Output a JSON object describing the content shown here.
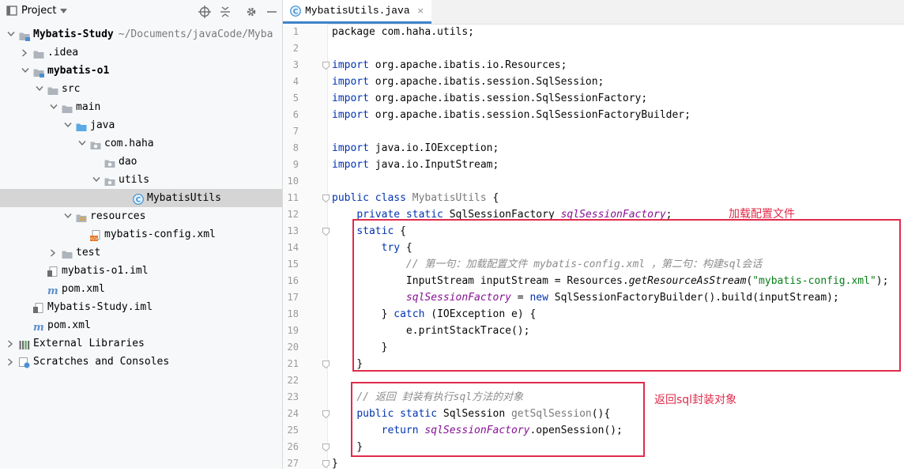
{
  "panel": {
    "title": "Project",
    "toolbar_icons": [
      "locate-icon",
      "collapse-icon",
      "gear-icon",
      "minimize-icon"
    ]
  },
  "tree": [
    {
      "label": "Mybatis-Study",
      "path": "~/Documents/javaCode/Myba",
      "indent": 0,
      "arrow": "down",
      "icon": "module-folder",
      "bold": true
    },
    {
      "label": ".idea",
      "indent": 1,
      "arrow": "right",
      "icon": "folder"
    },
    {
      "label": "mybatis-o1",
      "indent": 1,
      "arrow": "down",
      "icon": "module-folder",
      "bold": true
    },
    {
      "label": "src",
      "indent": 2,
      "arrow": "down",
      "icon": "folder"
    },
    {
      "label": "main",
      "indent": 3,
      "arrow": "down",
      "icon": "folder"
    },
    {
      "label": "java",
      "indent": 4,
      "arrow": "down",
      "icon": "source-folder"
    },
    {
      "label": "com.haha",
      "indent": 5,
      "arrow": "down",
      "icon": "package"
    },
    {
      "label": "dao",
      "indent": 6,
      "arrow": "none",
      "icon": "package"
    },
    {
      "label": "utils",
      "indent": 6,
      "arrow": "down",
      "icon": "package"
    },
    {
      "label": "MybatisUtils",
      "indent": 8,
      "arrow": "none",
      "icon": "class",
      "selected": true
    },
    {
      "label": "resources",
      "indent": 4,
      "arrow": "down",
      "icon": "resources-folder"
    },
    {
      "label": "mybatis-config.xml",
      "indent": 5,
      "arrow": "none",
      "icon": "xml"
    },
    {
      "label": "test",
      "indent": 3,
      "arrow": "right",
      "icon": "folder"
    },
    {
      "label": "mybatis-o1.iml",
      "indent": 2,
      "arrow": "none",
      "icon": "iml"
    },
    {
      "label": "pom.xml",
      "indent": 2,
      "arrow": "none",
      "icon": "maven"
    },
    {
      "label": "Mybatis-Study.iml",
      "indent": 1,
      "arrow": "none",
      "icon": "iml"
    },
    {
      "label": "pom.xml",
      "indent": 1,
      "arrow": "none",
      "icon": "maven"
    },
    {
      "label": "External Libraries",
      "indent": 0,
      "arrow": "right",
      "icon": "libraries"
    },
    {
      "label": "Scratches and Consoles",
      "indent": 0,
      "arrow": "right",
      "icon": "scratches"
    }
  ],
  "editor": {
    "tab_label": "MybatisUtils.java",
    "tab_close": "×",
    "lines": [
      [
        {
          "t": "package com.haha.utils;",
          "c": ""
        }
      ],
      [],
      [
        {
          "t": "import",
          "c": "kw"
        },
        {
          "t": " org.apache.ibatis.io.Resources;",
          "c": ""
        }
      ],
      [
        {
          "t": "import",
          "c": "kw"
        },
        {
          "t": " org.apache.ibatis.session.SqlSession;",
          "c": ""
        }
      ],
      [
        {
          "t": "import",
          "c": "kw"
        },
        {
          "t": " org.apache.ibatis.session.SqlSessionFactory;",
          "c": ""
        }
      ],
      [
        {
          "t": "import",
          "c": "kw"
        },
        {
          "t": " org.apache.ibatis.session.SqlSessionFactoryBuilder;",
          "c": ""
        }
      ],
      [],
      [
        {
          "t": "import",
          "c": "kw"
        },
        {
          "t": " java.io.IOException;",
          "c": ""
        }
      ],
      [
        {
          "t": "import",
          "c": "kw"
        },
        {
          "t": " java.io.InputStream;",
          "c": ""
        }
      ],
      [],
      [
        {
          "t": "public class ",
          "c": "kw"
        },
        {
          "t": "MybatisUtils",
          "c": "cls"
        },
        {
          "t": " {",
          "c": ""
        }
      ],
      [
        {
          "t": "    ",
          "c": ""
        },
        {
          "t": "private static ",
          "c": "kw"
        },
        {
          "t": "SqlSessionFactory ",
          "c": ""
        },
        {
          "t": "sqlSessionFactory",
          "c": "fld"
        },
        {
          "t": ";",
          "c": ""
        }
      ],
      [
        {
          "t": "    ",
          "c": ""
        },
        {
          "t": "static",
          "c": "kw"
        },
        {
          "t": " {",
          "c": ""
        }
      ],
      [
        {
          "t": "        ",
          "c": ""
        },
        {
          "t": "try",
          "c": "kw"
        },
        {
          "t": " {",
          "c": ""
        }
      ],
      [
        {
          "t": "            ",
          "c": ""
        },
        {
          "t": "// 第一句：加载配置文件 mybatis-config.xml ，第二句：构建sql会话",
          "c": "cmt"
        }
      ],
      [
        {
          "t": "            InputStream inputStream = Resources.",
          "c": ""
        },
        {
          "t": "getResourceAsStream",
          "c": "mth"
        },
        {
          "t": "(",
          "c": ""
        },
        {
          "t": "\"mybatis-config.xml\"",
          "c": "str"
        },
        {
          "t": ");",
          "c": ""
        }
      ],
      [
        {
          "t": "            ",
          "c": ""
        },
        {
          "t": "sqlSessionFactory",
          "c": "fld"
        },
        {
          "t": " = ",
          "c": ""
        },
        {
          "t": "new",
          "c": "kw"
        },
        {
          "t": " SqlSessionFactoryBuilder().build(inputStream);",
          "c": ""
        }
      ],
      [
        {
          "t": "        } ",
          "c": ""
        },
        {
          "t": "catch",
          "c": "kw"
        },
        {
          "t": " (IOException e) {",
          "c": ""
        }
      ],
      [
        {
          "t": "            e.printStackTrace();",
          "c": ""
        }
      ],
      [
        {
          "t": "        }",
          "c": ""
        }
      ],
      [
        {
          "t": "    }",
          "c": ""
        }
      ],
      [],
      [
        {
          "t": "    ",
          "c": ""
        },
        {
          "t": "// 返回 封装有执行sql方法的对象",
          "c": "cmt"
        }
      ],
      [
        {
          "t": "    ",
          "c": ""
        },
        {
          "t": "public static ",
          "c": "kw"
        },
        {
          "t": "SqlSession ",
          "c": ""
        },
        {
          "t": "getSqlSession",
          "c": "cls"
        },
        {
          "t": "(){",
          "c": ""
        }
      ],
      [
        {
          "t": "        ",
          "c": ""
        },
        {
          "t": "return ",
          "c": "kw"
        },
        {
          "t": "sqlSessionFactory",
          "c": "fld"
        },
        {
          "t": ".openSession();",
          "c": ""
        }
      ],
      [
        {
          "t": "    }",
          "c": ""
        }
      ],
      [
        {
          "t": "}",
          "c": ""
        }
      ]
    ],
    "line_numbers": [
      "1",
      "2",
      "3",
      "4",
      "5",
      "6",
      "7",
      "8",
      "9",
      "10",
      "11",
      "12",
      "13",
      "14",
      "15",
      "16",
      "17",
      "18",
      "19",
      "20",
      "21",
      "22",
      "23",
      "24",
      "25",
      "26",
      "27"
    ]
  },
  "annotations": {
    "load_config": "加载配置文件",
    "return_object": "返回sql封装对象",
    "color": "#e02b4b"
  }
}
